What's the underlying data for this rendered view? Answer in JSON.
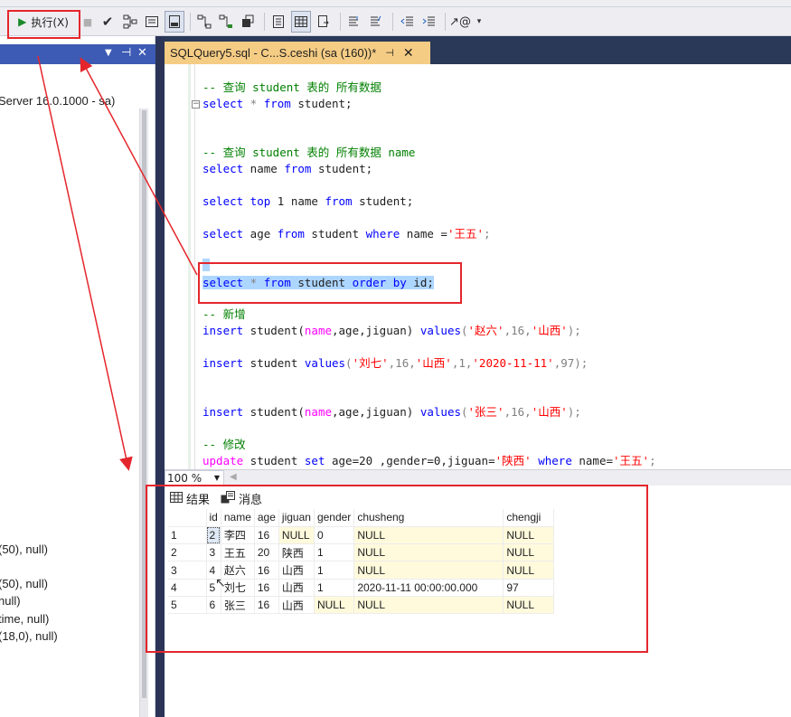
{
  "toolbar": {
    "execute_label": "执行(X)"
  },
  "editor": {
    "tab_title": "SQLQuery5.sql - C...S.ceshi (sa (160))*",
    "tab_pin": "⊣",
    "tab_close": "✕"
  },
  "left_panel": {
    "server_text": "Server 16.0.1000 - sa)",
    "columns": [
      "(50), null)",
      "(50), null)",
      "null)",
      "time, null)",
      "(18,0), null)"
    ]
  },
  "code": {
    "l1": "-- 查询 student 表的 所有数据",
    "l2_kw1": "select",
    "l2_rest": " * ",
    "l2_kw2": "from",
    "l2_id": " student;",
    "l3": "-- 查询 student 表的 所有数据 name",
    "l4_kw1": "select",
    "l4_id1": " name ",
    "l4_kw2": "from",
    "l4_id2": " student;",
    "l5_kw1": "select",
    "l5_kw2": " top ",
    "l5_num": "1",
    "l5_id1": " name ",
    "l5_kw3": "from",
    "l5_id2": " student;",
    "l6_kw1": "select",
    "l6_id1": " age ",
    "l6_kw2": "from",
    "l6_id2": " student ",
    "l6_kw3": "where",
    "l6_id3": " name =",
    "l6_str": "'王五'",
    "l6_end": ";",
    "l7_kw1": "select",
    "l7_gray": " * ",
    "l7_kw2": "from",
    "l7_id1": " student ",
    "l7_kw3": "order by",
    "l7_id2": " id;",
    "l8": "-- 新增",
    "l9_kw1": "insert",
    "l9_id1": " student(",
    "l9_id2": "name",
    "l9_id3": ",age,jiguan) ",
    "l9_kw2": "values",
    "l9_p": "(",
    "l9_s1": "'赵六'",
    "l9_c1": ",16,",
    "l9_s2": "'山西'",
    "l9_end": ");",
    "l10_kw1": "insert",
    "l10_id1": " student ",
    "l10_kw2": "values",
    "l10_p": "(",
    "l10_s1": "'刘七'",
    "l10_c1": ",16,",
    "l10_s2": "'山西'",
    "l10_c2": ",1,",
    "l10_s3": "'2020-11-11'",
    "l10_end": ",97);",
    "l11_kw1": "insert",
    "l11_id1": " student(",
    "l11_id2": "name",
    "l11_id3": ",age,jiguan) ",
    "l11_kw2": "values",
    "l11_p": "(",
    "l11_s1": "'张三'",
    "l11_c1": ",16,",
    "l11_s2": "'山西'",
    "l11_end": ");",
    "l12": "-- 修改",
    "l13_kw1": "update",
    "l13_id1": " student ",
    "l13_kw2": "set",
    "l13_id2": " age=20 ,gender=0,jiguan=",
    "l13_s1": "'陕西'",
    "l13_sp": " ",
    "l13_kw3": "where",
    "l13_id3": " name=",
    "l13_s2": "'王五'",
    "l13_end": ";"
  },
  "zoom": {
    "value": "100 %"
  },
  "results": {
    "tab_results": "结果",
    "tab_messages": "消息",
    "columns": [
      "id",
      "name",
      "age",
      "jiguan",
      "gender",
      "chusheng",
      "chengji"
    ],
    "rows": [
      [
        "1",
        "2",
        "李四",
        "16",
        "NULL",
        "0",
        "NULL",
        "NULL"
      ],
      [
        "2",
        "3",
        "王五",
        "20",
        "陕西",
        "1",
        "NULL",
        "NULL"
      ],
      [
        "3",
        "4",
        "赵六",
        "16",
        "山西",
        "1",
        "NULL",
        "NULL"
      ],
      [
        "4",
        "5",
        "刘七",
        "16",
        "山西",
        "1",
        "2020-11-11 00:00:00.000",
        "97"
      ],
      [
        "5",
        "6",
        "张三",
        "16",
        "山西",
        "NULL",
        "NULL",
        "NULL"
      ]
    ]
  },
  "colors": {
    "keyword": "#0000ff",
    "comment": "#008000",
    "string": "#ff0000",
    "tab_active": "#f5cc84",
    "annotation": "#e4262c"
  }
}
